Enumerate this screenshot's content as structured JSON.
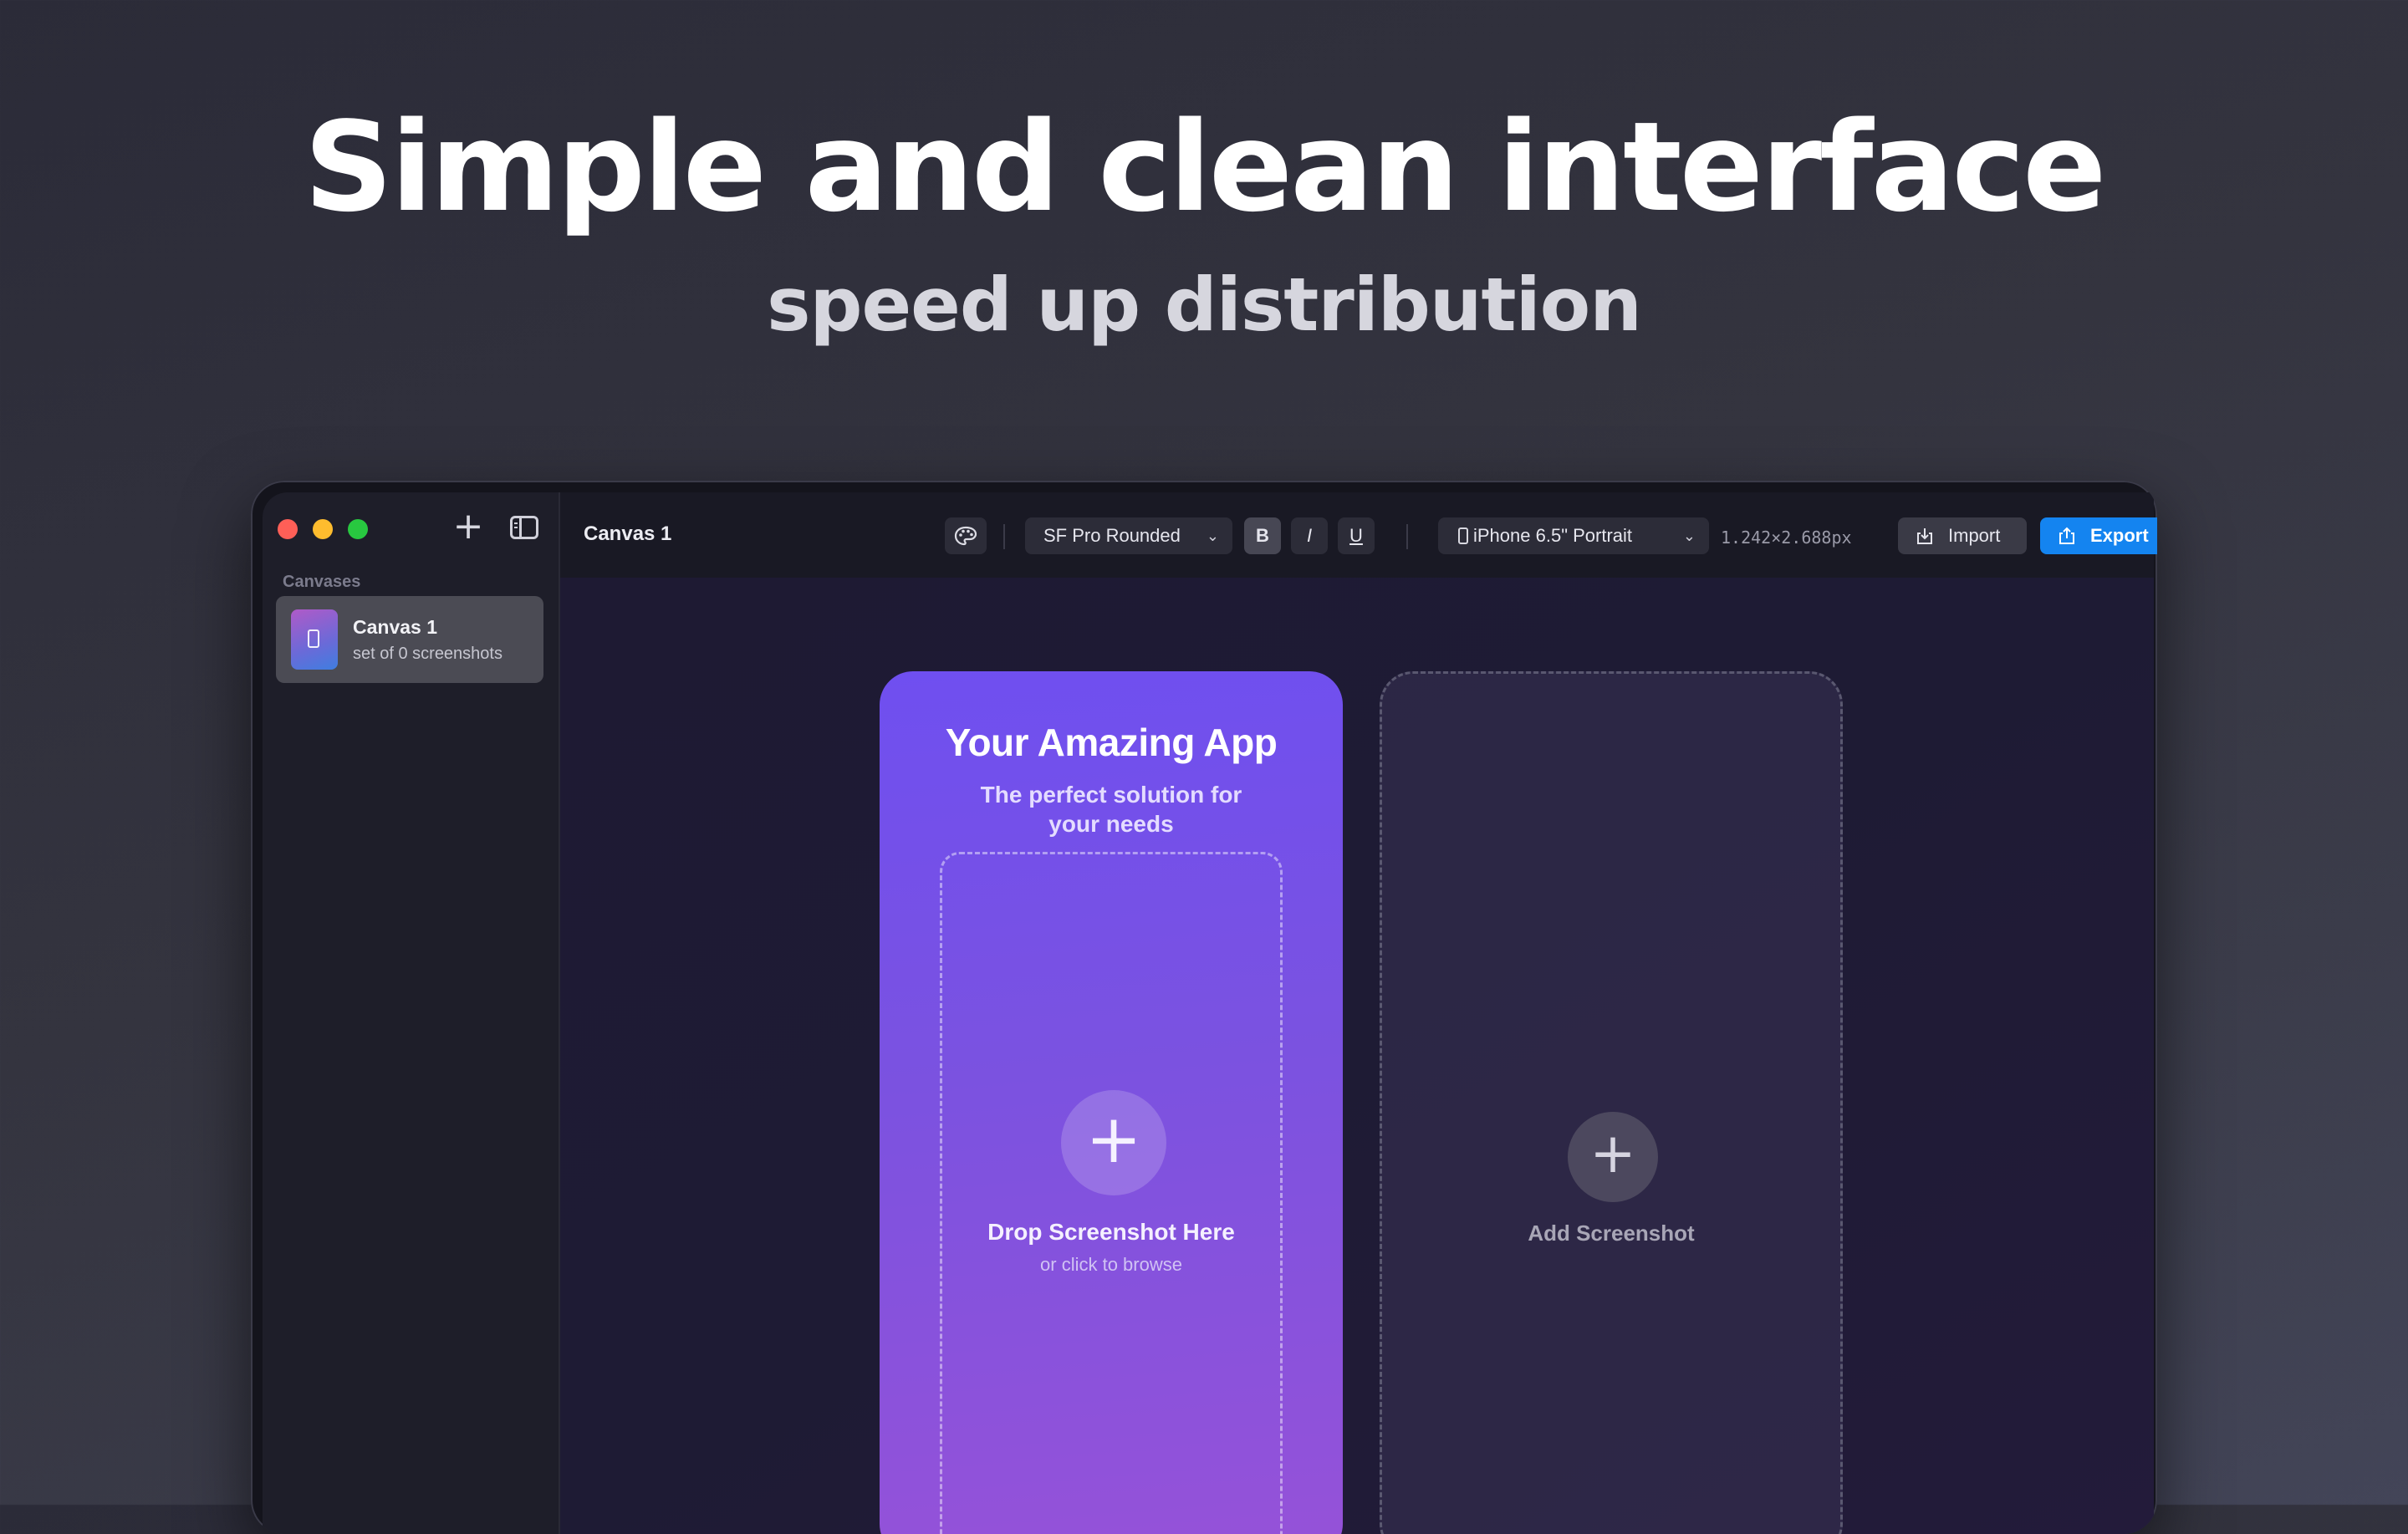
{
  "hero": {
    "title": "Simple and clean interface",
    "subtitle": "speed up distribution"
  },
  "sidebar": {
    "add_icon": "plus-icon",
    "toggle_icon": "sidebar-toggle-icon",
    "section_label": "Canvases",
    "items": [
      {
        "name": "Canvas 1",
        "subtitle": "set of 0 screenshots",
        "icon": "phone-icon"
      }
    ]
  },
  "toolbar": {
    "title": "Canvas 1",
    "palette_icon": "palette-icon",
    "font": "SF Pro Rounded",
    "bold_label": "B",
    "italic_label": "I",
    "underline_label": "U",
    "device": "iPhone 6.5\" Portrait",
    "dimensions": "1.242×2.688px",
    "import_label": "Import",
    "export_label": "Export",
    "accent_color": "#1484f0"
  },
  "canvas": {
    "card": {
      "title": "Your Amazing App",
      "subtitle": "The perfect solution for your needs",
      "drop_label": "Drop Screenshot Here",
      "drop_hint": "or click to browse",
      "gradient_start": "#6f4ff0",
      "gradient_end": "#9652d8"
    },
    "add_slot": {
      "label": "Add Screenshot"
    }
  }
}
